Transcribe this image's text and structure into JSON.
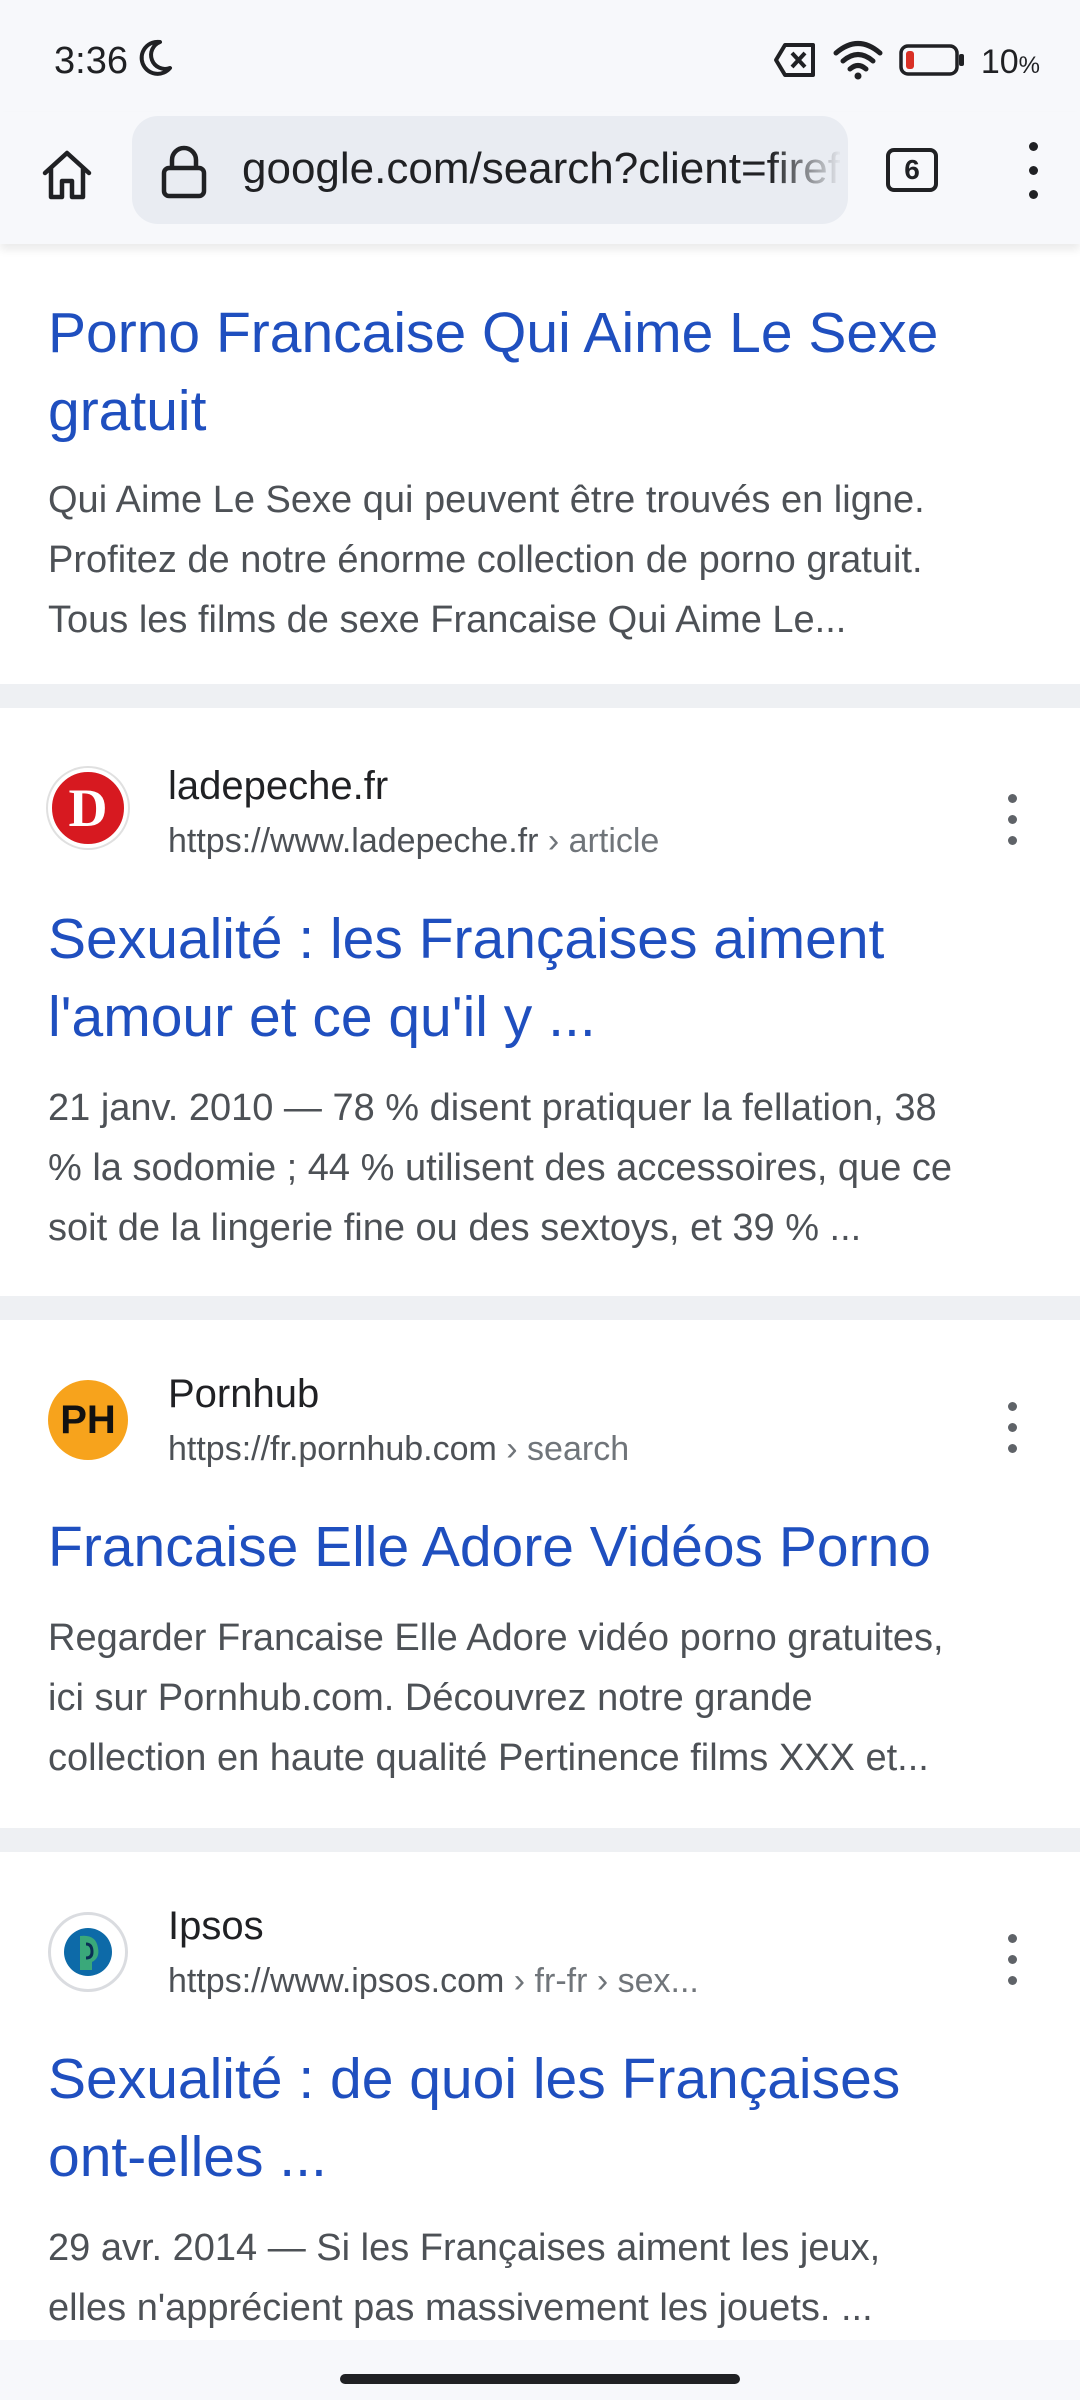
{
  "status": {
    "time": "3:36",
    "battery_pct": "10",
    "battery_pct_sign": "%"
  },
  "toolbar": {
    "url": "google.com/search?client=firefox",
    "tab_count": "6"
  },
  "results": [
    {
      "title_lines": [
        "Porno Francaise Qui Aime Le Sexe",
        "gratuit"
      ],
      "snippet_lines": [
        "Qui Aime Le Sexe qui peuvent être trouvés en ligne.",
        "Profitez de notre énorme collection de porno gratuit.",
        "Tous les films de sexe Francaise Qui Aime Le..."
      ]
    },
    {
      "site": "ladepeche.fr",
      "url": "https://www.ladepeche.fr",
      "breadcrumb": " › article",
      "favicon_text": "D",
      "title_lines": [
        "Sexualité : les Françaises aiment",
        "l'amour et ce qu'il y ..."
      ],
      "snippet_lines": [
        "21 janv. 2010 — 78 % disent pratiquer la fellation, 38",
        "% la sodomie ; 44 % utilisent des accessoires, que ce",
        "soit de la lingerie fine ou des sextoys, et 39 % ..."
      ]
    },
    {
      "site": "Pornhub",
      "url": "https://fr.pornhub.com",
      "breadcrumb": " › search",
      "favicon_text": "PH",
      "title_lines": [
        "Francaise Elle Adore Vidéos Porno"
      ],
      "snippet_lines": [
        "Regarder Francaise Elle Adore vidéo porno gratuites,",
        "ici sur Pornhub.com. Découvrez notre grande",
        "collection en haute qualité Pertinence films XXX et..."
      ]
    },
    {
      "site": "Ipsos",
      "url": "https://www.ipsos.com",
      "breadcrumb": " › fr-fr › sex...",
      "title_lines": [
        "Sexualité : de quoi les Françaises",
        "ont-elles ..."
      ],
      "snippet_lines": [
        "29 avr. 2014 — Si les Françaises aiment les jeux,",
        "elles n'apprécient pas massivement les jouets. ..."
      ]
    }
  ],
  "colors": {
    "link": "#1f4fbf",
    "ladepeche_red": "#d71920",
    "pornhub_orange": "#f7a31c",
    "ipsos_blue": "#0d6aa8"
  }
}
